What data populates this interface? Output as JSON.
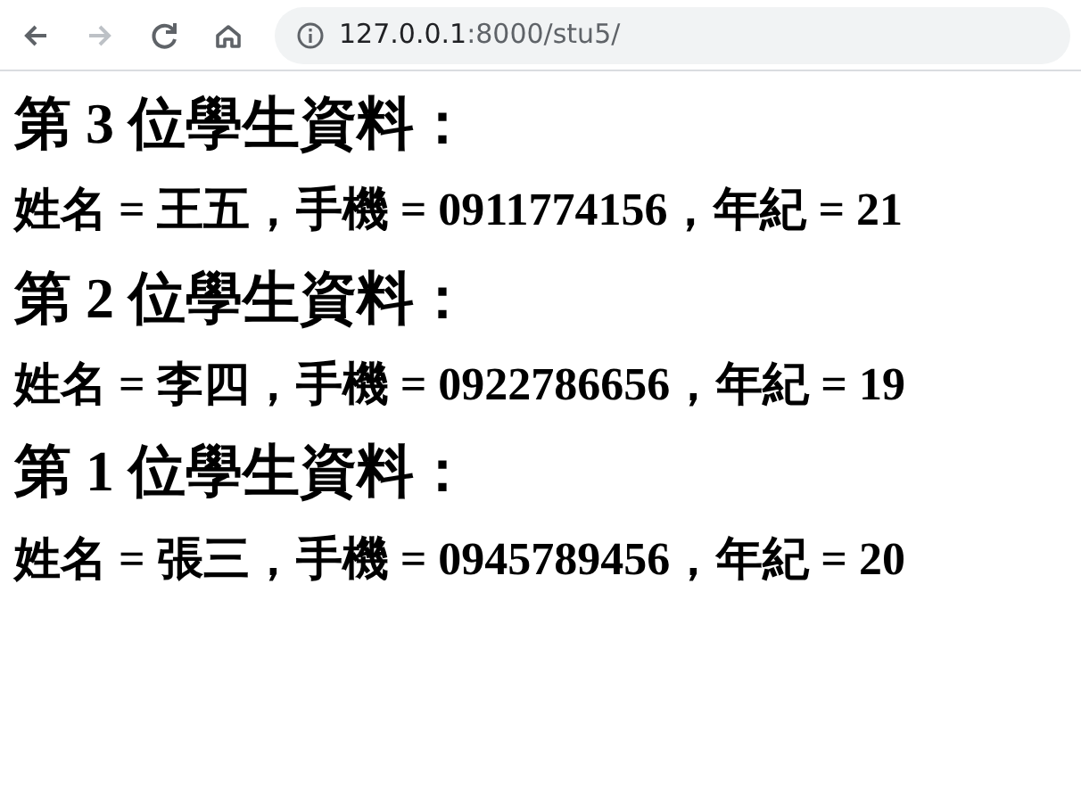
{
  "toolbar": {
    "buttons": [
      {
        "kind": "back",
        "disabled": false
      },
      {
        "kind": "forward",
        "disabled": true
      },
      {
        "kind": "reload",
        "disabled": false
      },
      {
        "kind": "home",
        "disabled": false
      }
    ],
    "address": {
      "host": "127.0.0.1",
      "path": ":8000/stu5/"
    }
  },
  "students": [
    {
      "heading": "第 3 位學生資料：",
      "info": "姓名 = 王五，手機 = 0911774156，年紀 = 21"
    },
    {
      "heading": "第 2 位學生資料：",
      "info": "姓名 = 李四，手機 = 0922786656，年紀 = 19"
    },
    {
      "heading": "第 1 位學生資料：",
      "info": "姓名 = 張三，手機 = 0945789456，年紀 = 20"
    }
  ]
}
